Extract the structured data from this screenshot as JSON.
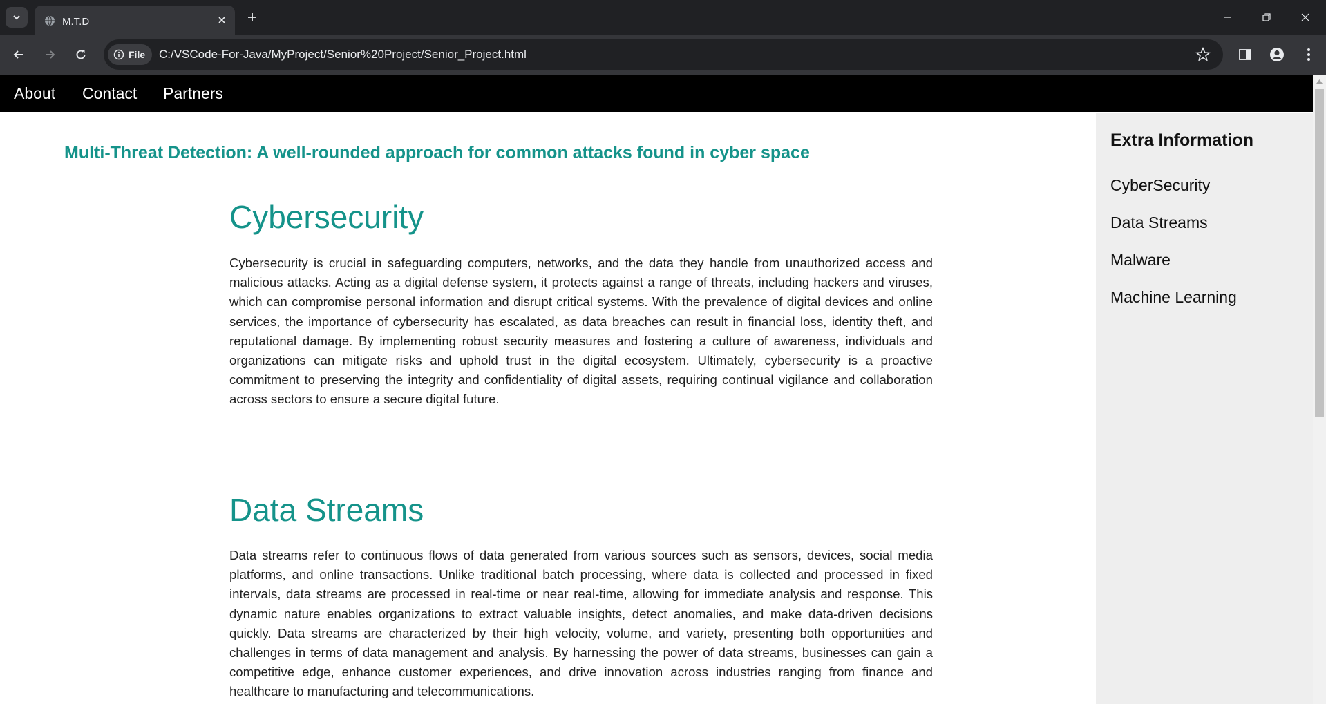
{
  "browser": {
    "tab_title": "M.T.D",
    "address_chip": "File",
    "url": "C:/VSCode-For-Java/MyProject/Senior%20Project/Senior_Project.html"
  },
  "nav": {
    "items": [
      {
        "label": "About"
      },
      {
        "label": "Contact"
      },
      {
        "label": "Partners"
      }
    ]
  },
  "main": {
    "headline": "Multi-Threat Detection: A well-rounded approach for common attacks found in cyber space",
    "sections": [
      {
        "title": "Cybersecurity",
        "body": "Cybersecurity is crucial in safeguarding computers, networks, and the data they handle from unauthorized access and malicious attacks. Acting as a digital defense system, it protects against a range of threats, including hackers and viruses, which can compromise personal information and disrupt critical systems. With the prevalence of digital devices and online services, the importance of cybersecurity has escalated, as data breaches can result in financial loss, identity theft, and reputational damage. By implementing robust security measures and fostering a culture of awareness, individuals and organizations can mitigate risks and uphold trust in the digital ecosystem. Ultimately, cybersecurity is a proactive commitment to preserving the integrity and confidentiality of digital assets, requiring continual vigilance and collaboration across sectors to ensure a secure digital future."
      },
      {
        "title": "Data Streams",
        "body": "Data streams refer to continuous flows of data generated from various sources such as sensors, devices, social media platforms, and online transactions. Unlike traditional batch processing, where data is collected and processed in fixed intervals, data streams are processed in real-time or near real-time, allowing for immediate analysis and response. This dynamic nature enables organizations to extract valuable insights, detect anomalies, and make data-driven decisions quickly. Data streams are characterized by their high velocity, volume, and variety, presenting both opportunities and challenges in terms of data management and analysis. By harnessing the power of data streams, businesses can gain a competitive edge, enhance customer experiences, and drive innovation across industries ranging from finance and healthcare to manufacturing and telecommunications."
      }
    ]
  },
  "sidebar": {
    "heading": "Extra Information",
    "links": [
      {
        "label": "CyberSecurity"
      },
      {
        "label": "Data Streams"
      },
      {
        "label": "Malware"
      },
      {
        "label": "Machine Learning"
      }
    ]
  },
  "colors": {
    "accent": "#15938a",
    "navbar": "#000000",
    "sidebar": "#eeeeee"
  }
}
